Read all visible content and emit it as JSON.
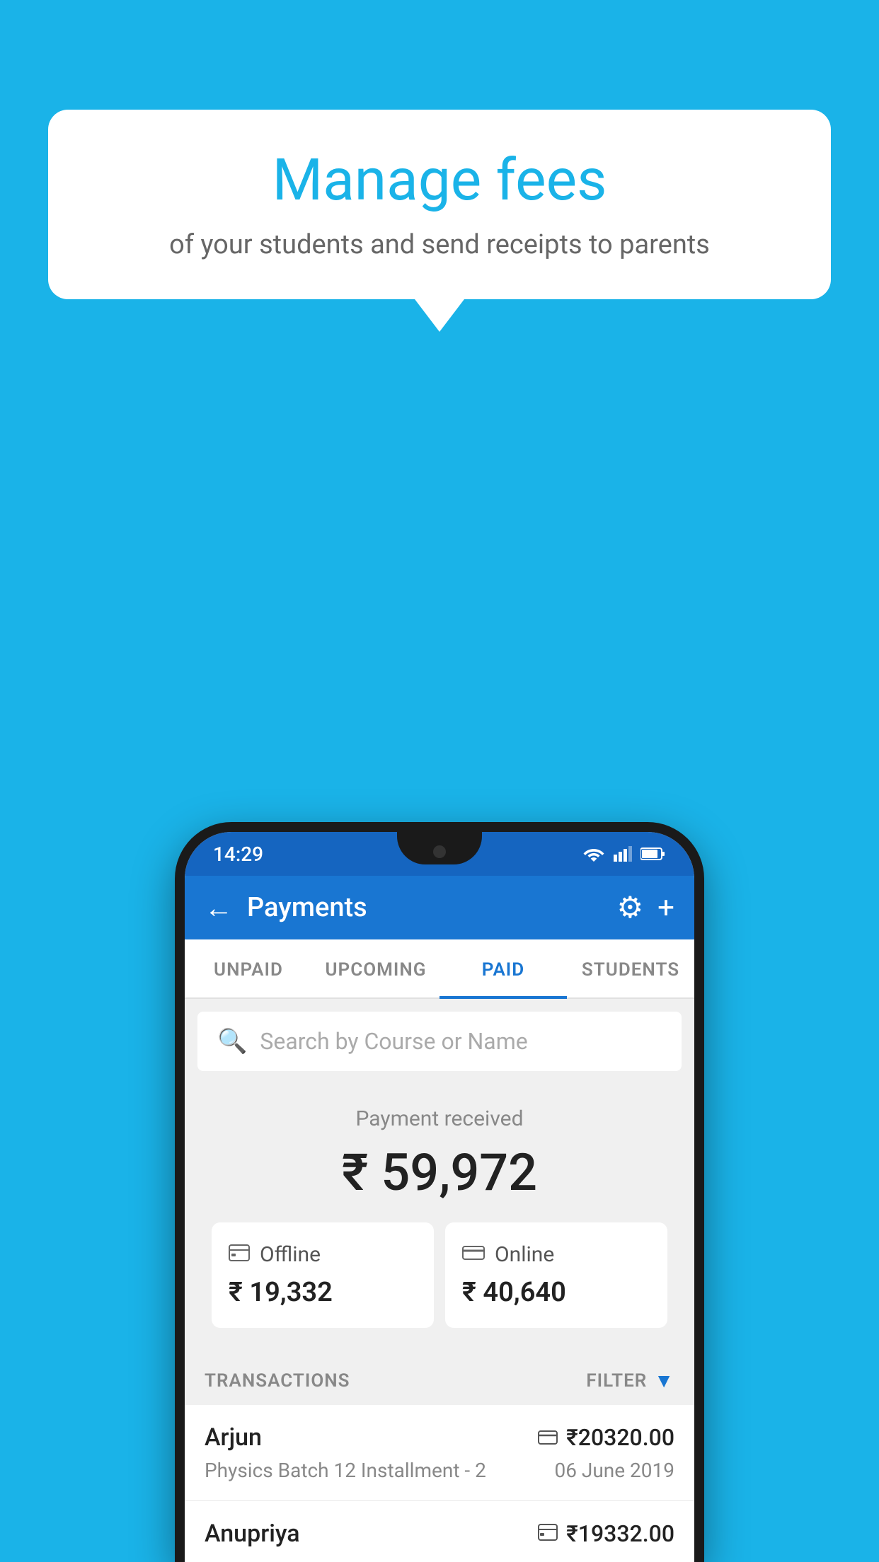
{
  "background_color": "#1ab3e8",
  "tooltip": {
    "title": "Manage fees",
    "subtitle": "of your students and send receipts to parents"
  },
  "status_bar": {
    "time": "14:29",
    "color": "#1565c0"
  },
  "app_bar": {
    "title": "Payments",
    "back_label": "←",
    "settings_label": "⚙",
    "add_label": "+"
  },
  "tabs": [
    {
      "label": "UNPAID",
      "active": false
    },
    {
      "label": "UPCOMING",
      "active": false
    },
    {
      "label": "PAID",
      "active": true
    },
    {
      "label": "STUDENTS",
      "active": false
    }
  ],
  "search": {
    "placeholder": "Search by Course or Name"
  },
  "payment_summary": {
    "label": "Payment received",
    "total_amount": "₹ 59,972",
    "offline": {
      "type": "Offline",
      "amount": "₹ 19,332"
    },
    "online": {
      "type": "Online",
      "amount": "₹ 40,640"
    }
  },
  "transactions": {
    "label": "TRANSACTIONS",
    "filter_label": "FILTER",
    "items": [
      {
        "name": "Arjun",
        "course": "Physics Batch 12 Installment - 2",
        "amount": "₹20320.00",
        "date": "06 June 2019",
        "payment_type": "online"
      },
      {
        "name": "Anupriya",
        "course": "",
        "amount": "₹19332.00",
        "date": "",
        "payment_type": "offline"
      }
    ]
  }
}
